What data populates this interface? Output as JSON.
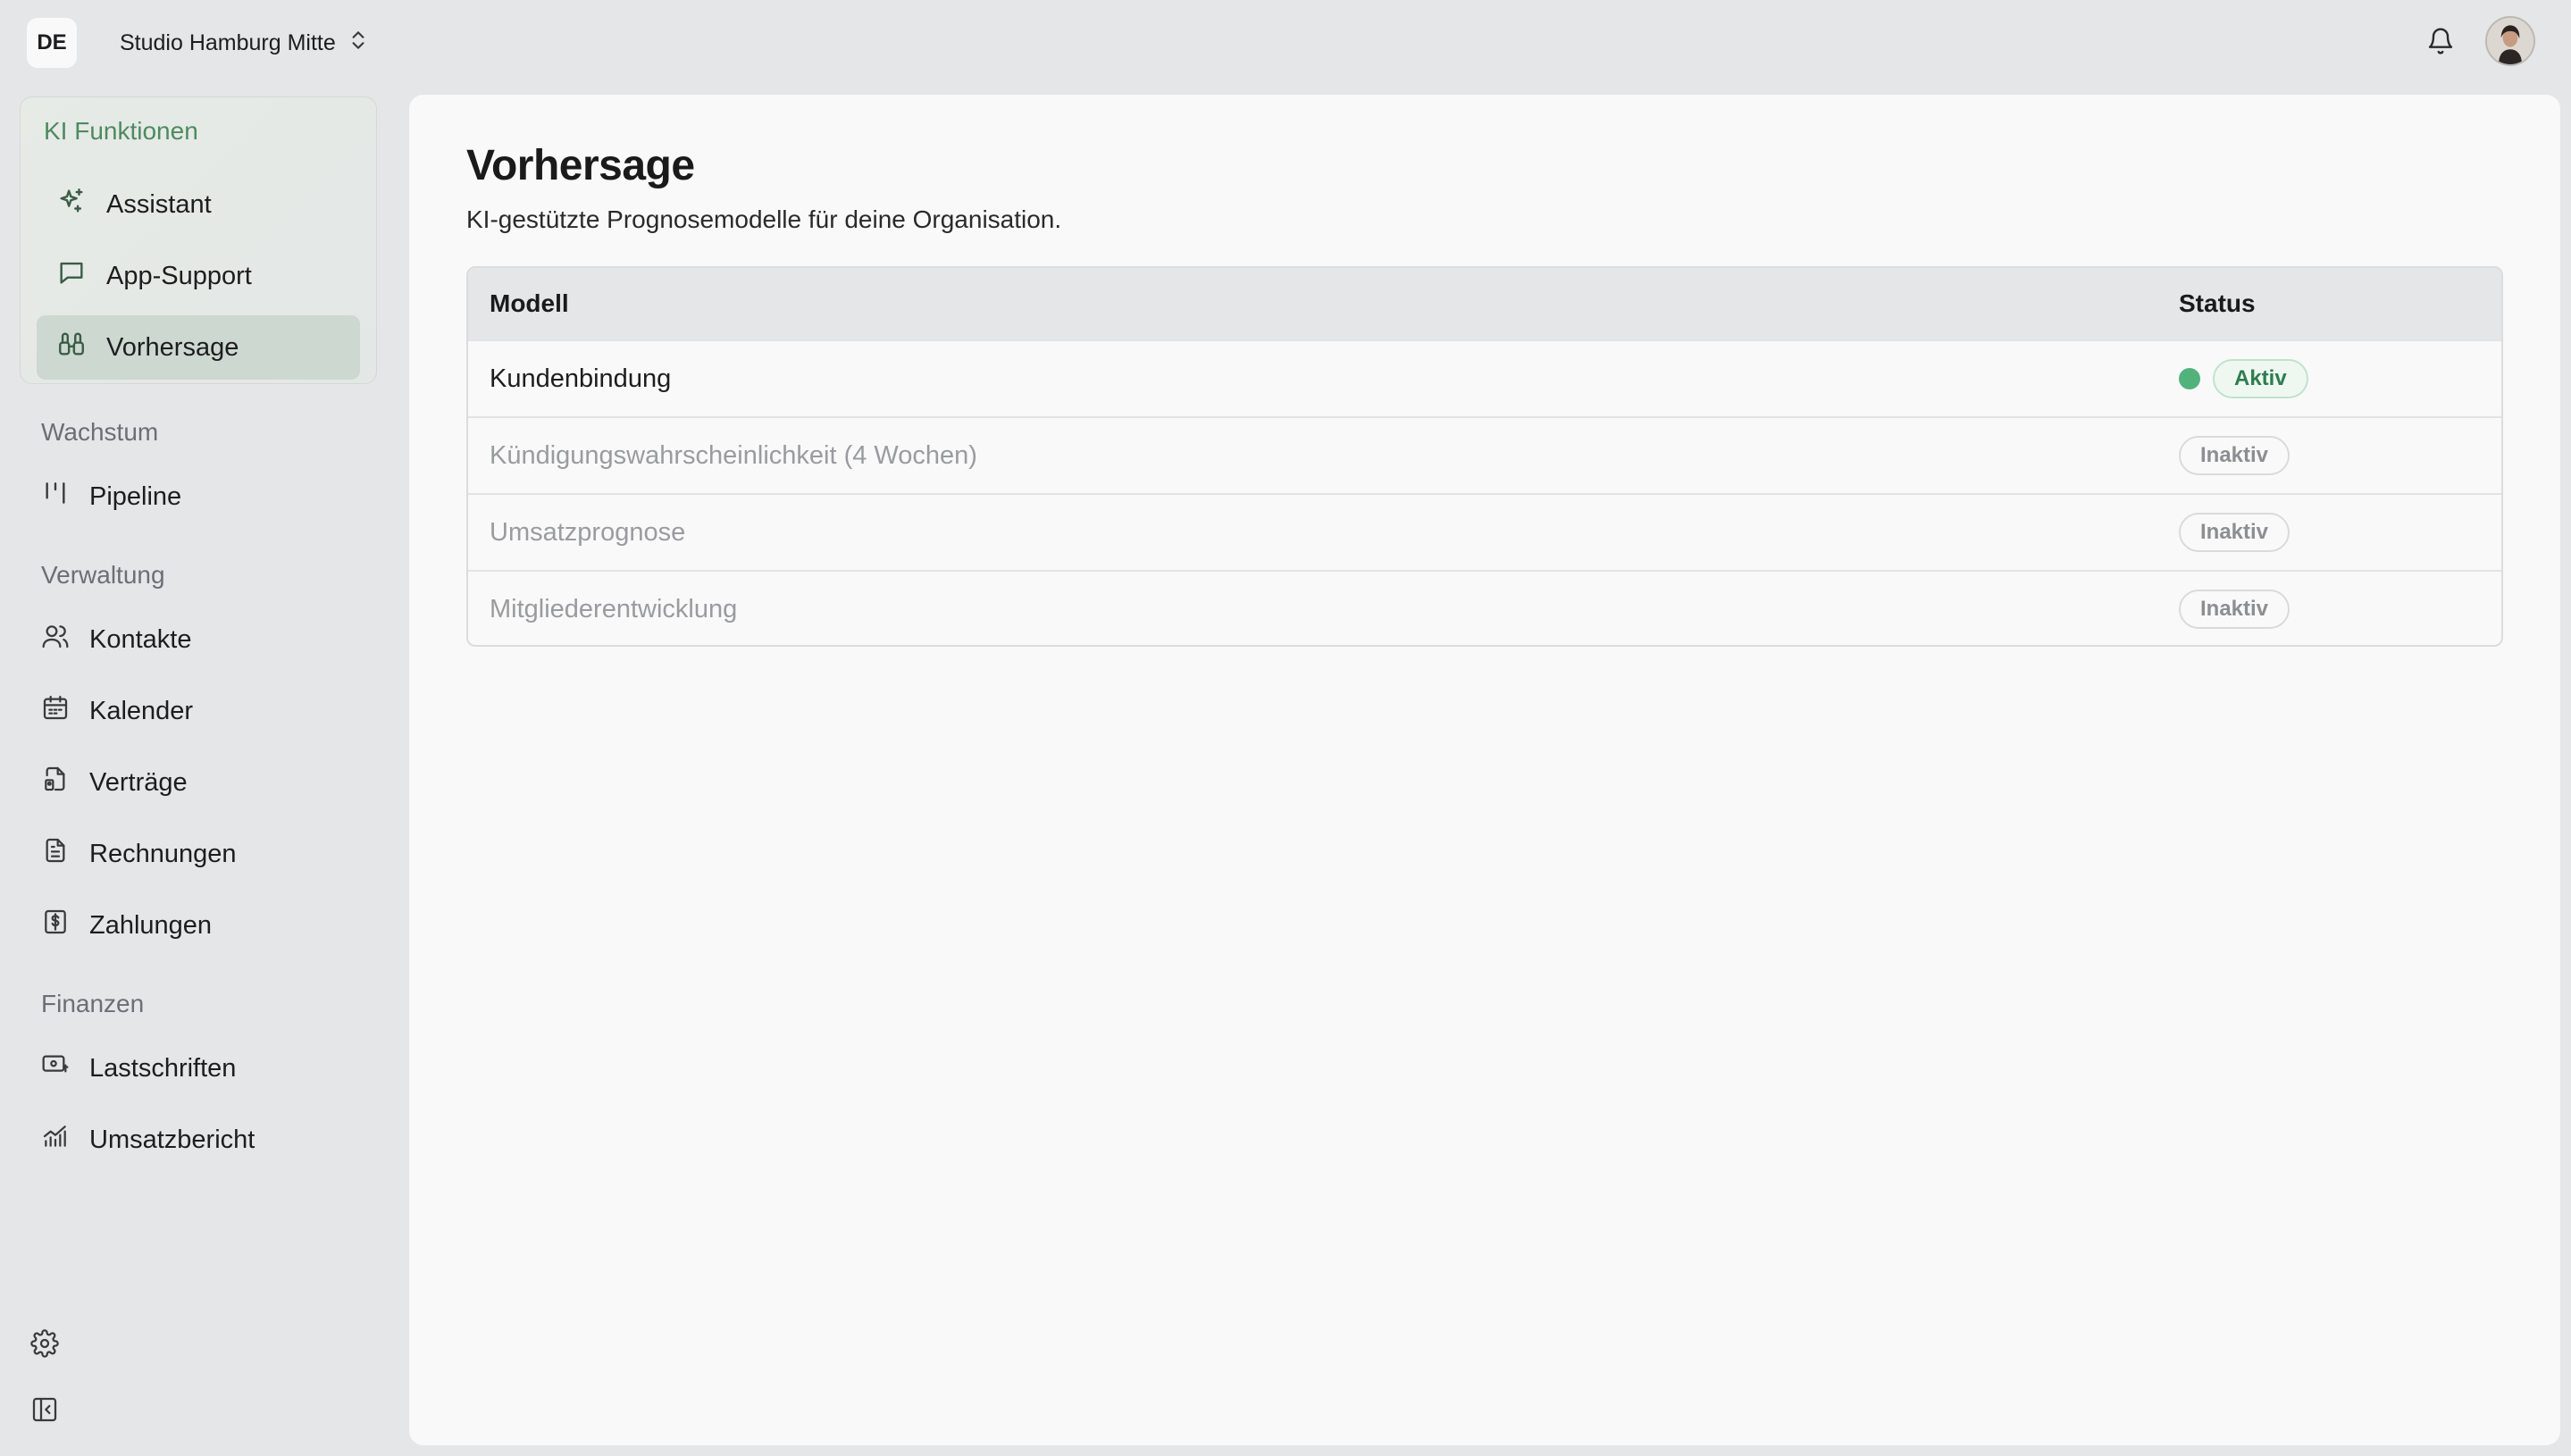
{
  "header": {
    "org_badge": "DE",
    "org_name": "Studio Hamburg Mitte"
  },
  "sidebar": {
    "ai_section_title": "KI Funktionen",
    "ai_items": [
      {
        "label": "Assistant",
        "icon": "sparkles-icon"
      },
      {
        "label": "App-Support",
        "icon": "chat-bubble-icon"
      },
      {
        "label": "Vorhersage",
        "icon": "binoculars-icon",
        "active": true
      }
    ],
    "sections": [
      {
        "title": "Wachstum",
        "items": [
          {
            "label": "Pipeline",
            "icon": "kanban-icon"
          }
        ]
      },
      {
        "title": "Verwaltung",
        "items": [
          {
            "label": "Kontakte",
            "icon": "users-icon"
          },
          {
            "label": "Kalender",
            "icon": "calendar-icon"
          },
          {
            "label": "Verträge",
            "icon": "contract-icon"
          },
          {
            "label": "Rechnungen",
            "icon": "invoice-icon"
          },
          {
            "label": "Zahlungen",
            "icon": "dollar-receipt-icon"
          }
        ]
      },
      {
        "title": "Finanzen",
        "items": [
          {
            "label": "Lastschriften",
            "icon": "direct-debit-icon"
          },
          {
            "label": "Umsatzbericht",
            "icon": "bar-chart-icon"
          }
        ]
      }
    ]
  },
  "main": {
    "title": "Vorhersage",
    "subtitle": "KI-gestützte Prognosemodelle für deine Organisation.",
    "table": {
      "columns": [
        "Modell",
        "Status"
      ],
      "rows": [
        {
          "name": "Kundenbindung",
          "status": "Aktiv",
          "active": true
        },
        {
          "name": "Kündigungswahrscheinlichkeit (4 Wochen)",
          "status": "Inaktiv",
          "active": false
        },
        {
          "name": "Umsatzprognose",
          "status": "Inaktiv",
          "active": false
        },
        {
          "name": "Mitgliederentwicklung",
          "status": "Inaktiv",
          "active": false
        }
      ]
    }
  },
  "colors": {
    "accent_green": "#4e8a5f",
    "status_active": "#52b27c",
    "background": "#e5e6e8",
    "panel": "#f9f9f9"
  }
}
